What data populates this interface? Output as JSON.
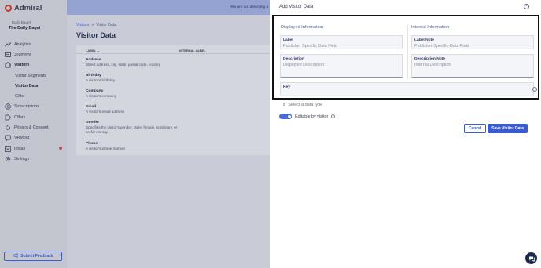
{
  "app": {
    "name": "Admiral"
  },
  "publisher": {
    "label": "Daily Bagel",
    "name": "The Daily Bagel"
  },
  "sidebar": {
    "items": [
      {
        "label": "Analytics",
        "icon": "analytics-icon"
      },
      {
        "label": "Journeys",
        "icon": "journeys-icon"
      },
      {
        "label": "Visitors",
        "icon": "visitors-icon"
      },
      {
        "label": "Visitor Segments"
      },
      {
        "label": "Visitor Data",
        "active": true
      },
      {
        "label": "Gifts"
      },
      {
        "label": "Subscriptions",
        "icon": "subscriptions-icon"
      },
      {
        "label": "Offers",
        "icon": "offers-icon"
      },
      {
        "label": "Privacy & Consent",
        "icon": "privacy-icon"
      },
      {
        "label": "VRMbot",
        "icon": "vrmbot-icon"
      },
      {
        "label": "Install",
        "icon": "install-icon",
        "badge": true
      },
      {
        "label": "Settings",
        "icon": "settings-icon"
      }
    ],
    "feedback_label": "Submit Feedback"
  },
  "banner": {
    "text": "We are not detecting a"
  },
  "breadcrumb": {
    "parent": "Visitors",
    "separator": "»",
    "current": "Visitor Data"
  },
  "page": {
    "title": "Visitor Data"
  },
  "table": {
    "columns": [
      "LABEL ⌄",
      "INTERNAL LABEL"
    ],
    "rows": [
      {
        "title": "Address",
        "desc": "Street address, city, state, postal code, country"
      },
      {
        "title": "Birthday",
        "desc": "A visitor's birthday"
      },
      {
        "title": "Company",
        "desc": "A visitor's company"
      },
      {
        "title": "Email",
        "desc": "A visitor's email address"
      },
      {
        "title": "Gender",
        "desc": "Specifies the visitor's gender: Male, female, nonbinary, or prefer not say."
      },
      {
        "title": "Phone",
        "desc": "A visitor's phone number"
      }
    ]
  },
  "drawer": {
    "title": "Add Visitor Data",
    "displayed_heading": "Displayed Information",
    "internal_heading": "Internal Information",
    "label_field": {
      "label": "Label",
      "placeholder": "Publisher Specific Data Field"
    },
    "description_field": {
      "label": "Description",
      "placeholder": "Displayed Description"
    },
    "label_note_field": {
      "label": "Label Note",
      "placeholder": "Publisher-Specific-Data-Field"
    },
    "description_note_field": {
      "label": "Description Note",
      "placeholder": "Internal Description"
    },
    "key_field": {
      "label": "Key",
      "value": ""
    },
    "data_type": {
      "placeholder": "Select a data type"
    },
    "editable": {
      "label": "Editable by visitor",
      "on": true
    },
    "cancel_label": "Cancel",
    "save_label": "Save Visitor Data"
  },
  "colors": {
    "accent": "#3a5bd8",
    "sidebar": "#c4c6cf",
    "banner": "#95a3d3"
  }
}
